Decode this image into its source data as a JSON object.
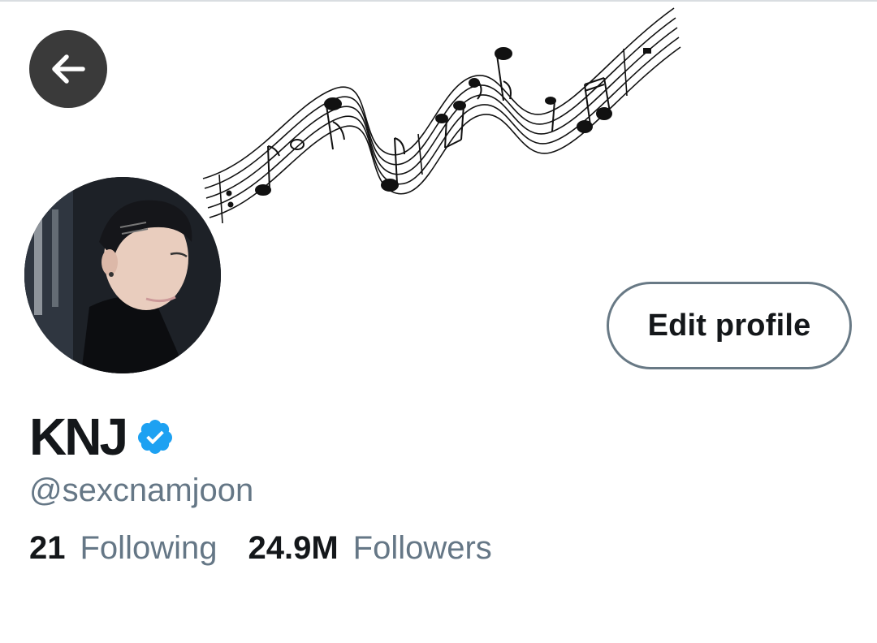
{
  "header": {
    "back_icon": "arrow-left-icon",
    "back_button_color": "#3a3a3a"
  },
  "banner": {
    "description_icon": "music-staff-illustration"
  },
  "profile": {
    "display_name": "KNJ",
    "verified": true,
    "verified_color": "#1da1f2",
    "handle": "@sexcnamjoon",
    "edit_button_label": "Edit profile"
  },
  "stats": {
    "following_count": "21",
    "following_label": "Following",
    "followers_count": "24.9M",
    "followers_label": "Followers"
  },
  "colors": {
    "text_primary": "#14171a",
    "text_secondary": "#657786",
    "button_border": "#687985"
  }
}
